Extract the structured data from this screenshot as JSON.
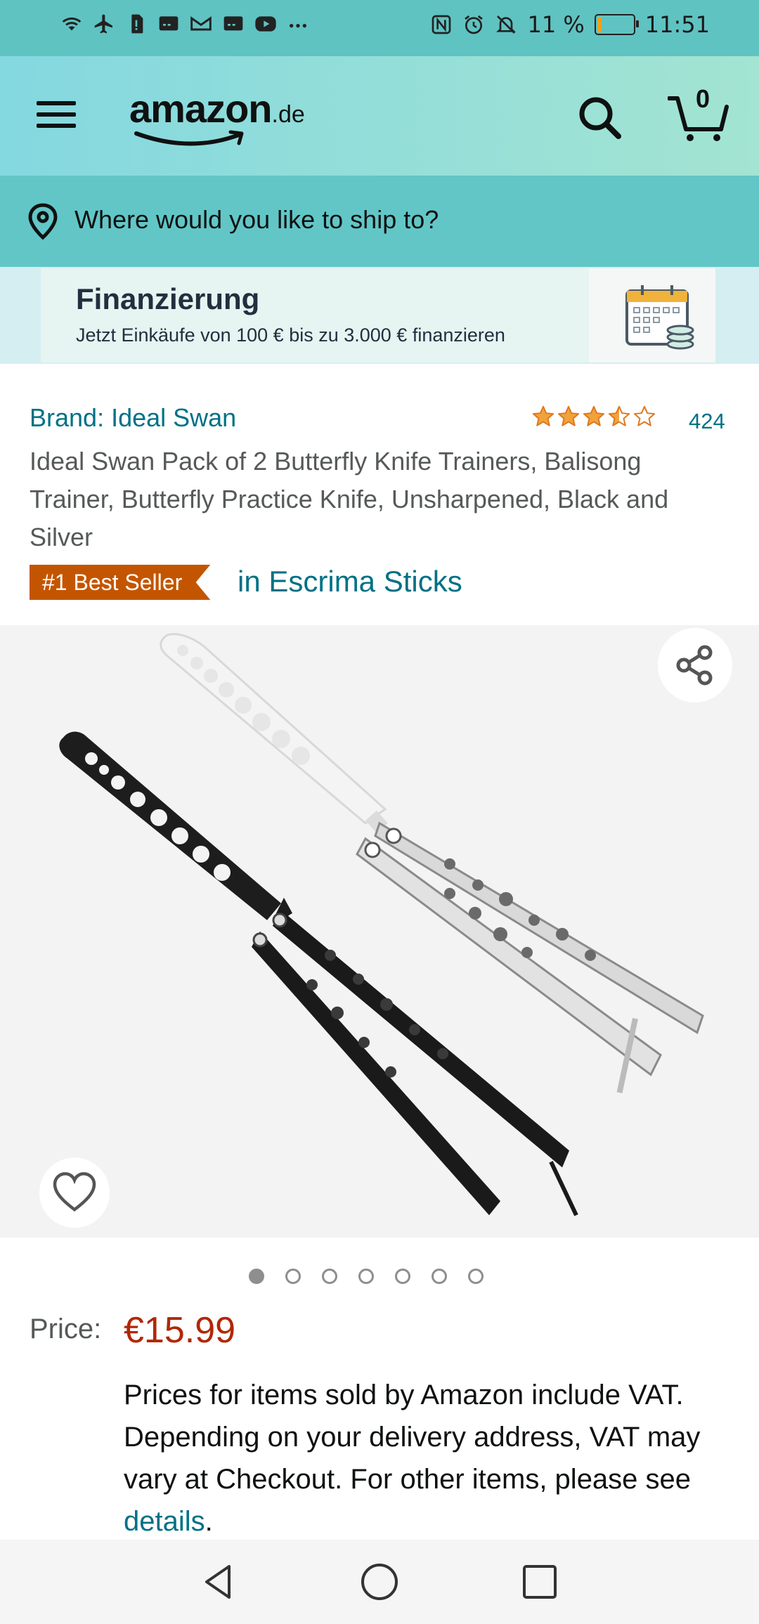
{
  "status_bar": {
    "battery_percent": "11 %",
    "time": "11:51",
    "battery_level": 0.11,
    "battery_color": "#f3a11a",
    "icons_left": [
      "wifi-icon",
      "airplane-icon",
      "sim-icon",
      "message-icon",
      "gmail-icon",
      "message-icon",
      "youtube-icon",
      "more-icon"
    ],
    "icons_right": [
      "nfc-icon",
      "alarm-icon",
      "mute-icon"
    ]
  },
  "header": {
    "logo_text": "amazon",
    "logo_tld": ".de",
    "cart_count": "0",
    "background": "#84d8e0"
  },
  "ship_bar": {
    "text": "Where would you like to ship to?",
    "background": "#62c6c7"
  },
  "banner": {
    "title": "Finanzierung",
    "subtitle": "Jetzt Einkäufe von 100 € bis zu 3.000 € finanzieren"
  },
  "product": {
    "brand": "Brand: Ideal Swan",
    "rating": 3.5,
    "rating_max": 5,
    "rating_count": "424",
    "title": "Ideal Swan Pack of 2 Butterfly Knife Trainers, Balisong Trainer, Butterfly Practice Knife, Unsharpened, Black and Silver",
    "badge": "#1 Best Seller",
    "badge_category": "in Escrima Sticks",
    "badge_color": "#c45500",
    "image_count": 7,
    "image_index": 1
  },
  "price": {
    "label": "Price:",
    "value": "€15.99",
    "color": "#b12704",
    "vat_text": "Prices for items sold by Amazon include VAT. Depending on your delivery address, VAT may vary at Checkout. For other items, please see ",
    "vat_link": "details",
    "vat_end": "."
  }
}
